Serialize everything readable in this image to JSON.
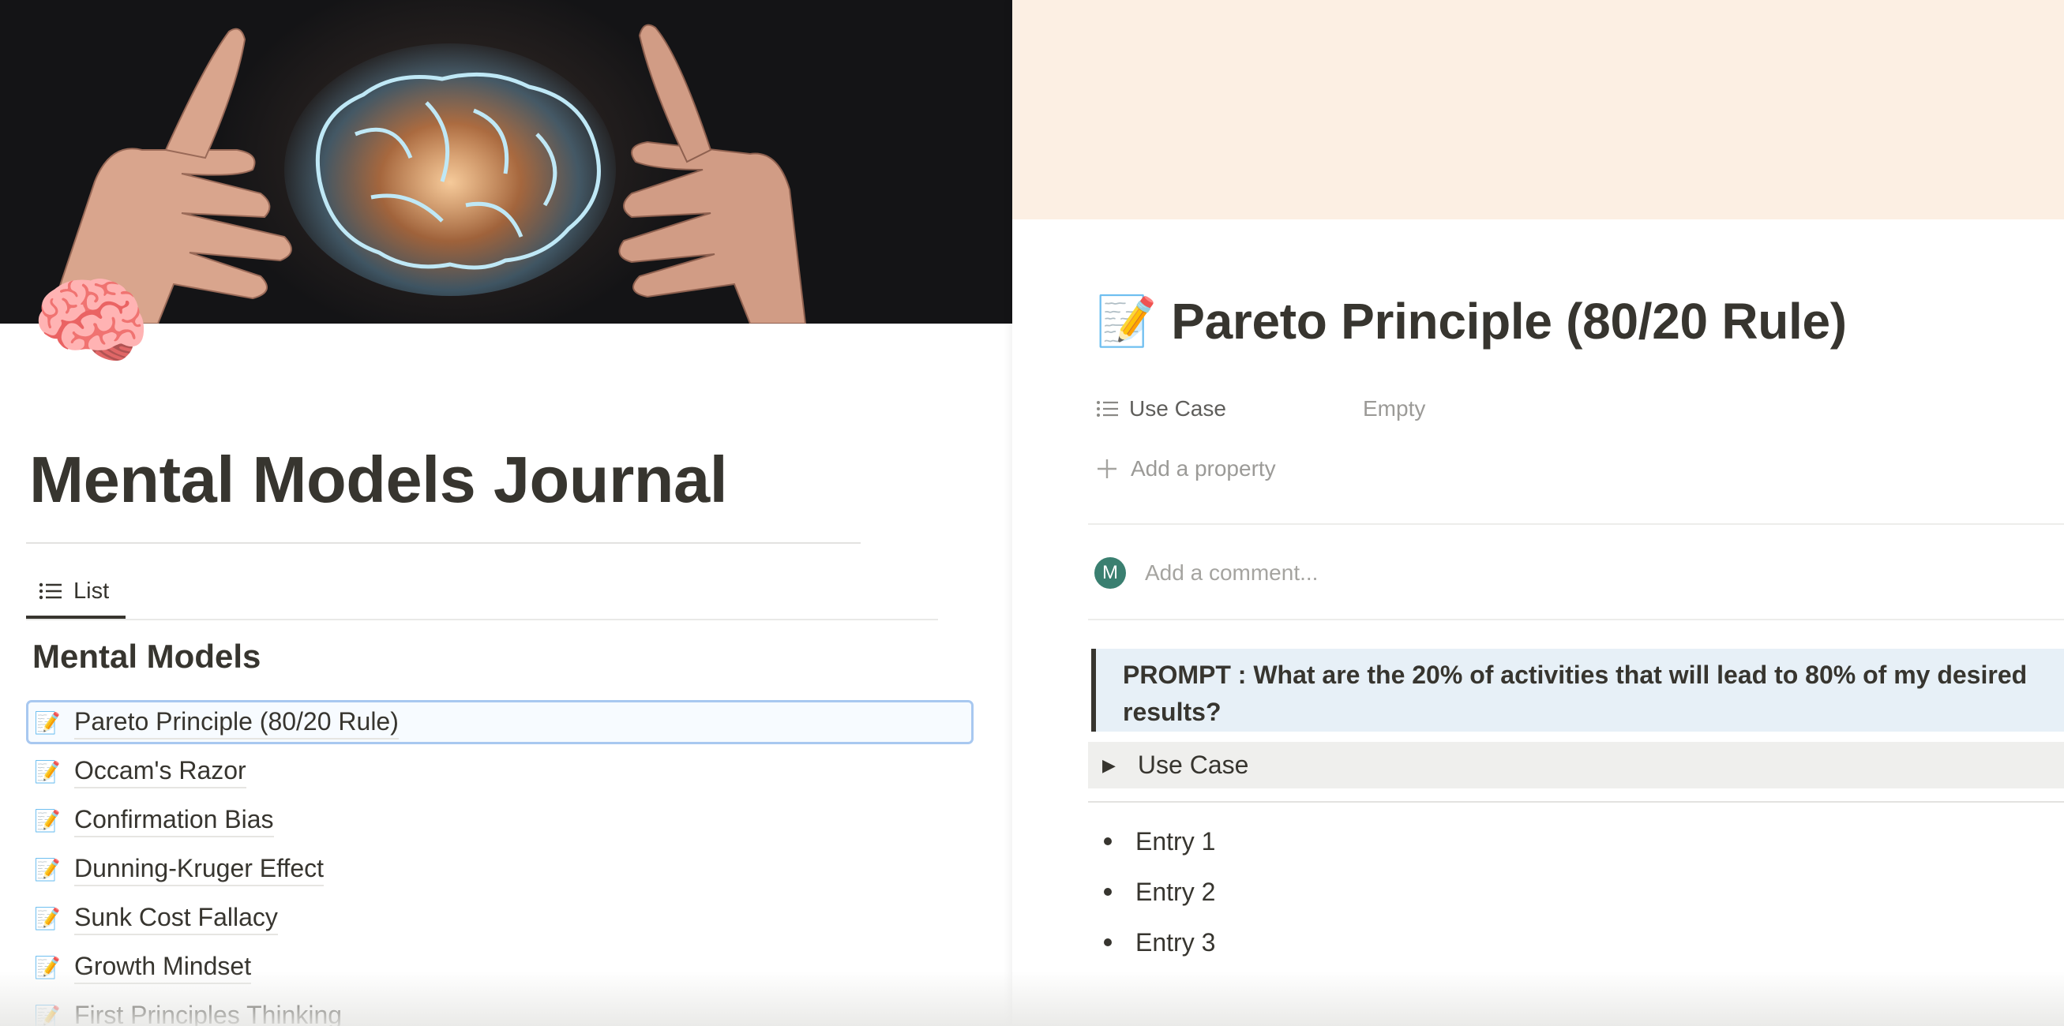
{
  "colors": {
    "text": "#37352f",
    "muted": "#9b9a97",
    "callout_bg": "#e7f0f7",
    "peek_cover": "#fcefe3",
    "selection_border": "#a8c8f0",
    "avatar": "#3a7f70"
  },
  "left_page": {
    "cover_image": "glowing-brain-between-hands",
    "icon": "🧠",
    "title": "Mental Models Journal",
    "view_tab": {
      "icon": "list-icon",
      "label": "List"
    },
    "database_title": "Mental Models",
    "items": [
      {
        "icon": "📝",
        "label": "Pareto Principle (80/20 Rule)",
        "selected": true
      },
      {
        "icon": "📝",
        "label": "Occam's Razor"
      },
      {
        "icon": "📝",
        "label": "Confirmation Bias"
      },
      {
        "icon": "📝",
        "label": "Dunning-Kruger Effect"
      },
      {
        "icon": "📝",
        "label": "Sunk Cost Fallacy"
      },
      {
        "icon": "📝",
        "label": "Growth Mindset"
      },
      {
        "icon": "📝",
        "label": "First Principles Thinking"
      }
    ]
  },
  "peek_page": {
    "icon": "📝",
    "title": "Pareto Principle (80/20 Rule)",
    "properties": [
      {
        "icon": "list-icon",
        "name": "Use Case",
        "value": "Empty"
      }
    ],
    "add_property_label": "Add a property",
    "comment": {
      "avatar_initial": "M",
      "placeholder": "Add a comment..."
    },
    "callout_text": "PROMPT : What are the 20% of activities that will lead to 80% of my desired results?",
    "toggle_label": "Use Case",
    "entries": [
      "Entry 1",
      "Entry 2",
      "Entry 3"
    ]
  }
}
